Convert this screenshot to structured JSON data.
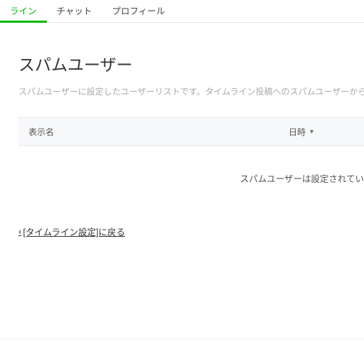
{
  "tabs": {
    "timeline": "ライン",
    "chat": "チャット",
    "profile": "プロフィール"
  },
  "page": {
    "title": "スパムユーザー",
    "description": "スパムユーザーに設定したユーザーリストです。タイムライン投稿へのスパムユーザーからのコメントは、すべて"
  },
  "table": {
    "col_name": "表示名",
    "col_date": "日時",
    "empty": "スパムユーザーは設定されてい"
  },
  "back": {
    "label": "[タイムライン設定]に戻る"
  }
}
